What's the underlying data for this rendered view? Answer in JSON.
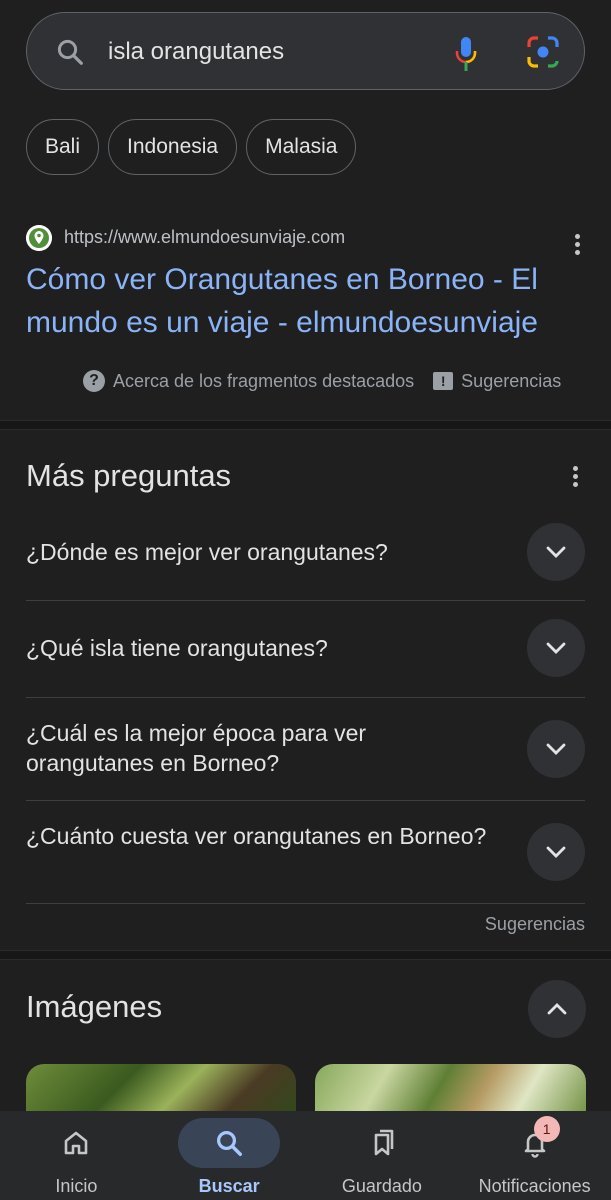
{
  "search": {
    "query": "isla orangutanes",
    "placeholder": "",
    "mic_icon": "mic-icon",
    "lens_icon": "google-lens-icon"
  },
  "chips": [
    "Bali",
    "Indonesia",
    "Malasia"
  ],
  "result": {
    "url": "https://www.elmundoesunviaje.com",
    "title": "Cómo ver Orangutanes en Borneo - El mundo es un viaje - elmundoesunviaje",
    "about_snippets": "Acerca de los fragmentos destacados",
    "suggestions": "Sugerencias"
  },
  "more_questions": {
    "title": "Más preguntas",
    "items": [
      "¿Dónde es mejor ver orangutanes?",
      "¿Qué isla tiene orangutanes?",
      "¿Cuál es la mejor época para ver orangutanes en Borneo?",
      "¿Cuánto cuesta ver orangutanes en Borneo?"
    ],
    "suggestions": "Sugerencias"
  },
  "images": {
    "title": "Imágenes"
  },
  "bottom_nav": {
    "items": [
      {
        "label": "Inicio",
        "icon": "home-icon"
      },
      {
        "label": "Buscar",
        "icon": "search-icon"
      },
      {
        "label": "Guardado",
        "icon": "bookmarks-icon"
      },
      {
        "label": "Notificaciones",
        "icon": "bell-icon"
      }
    ],
    "notification_badge": "1"
  },
  "colors": {
    "background": "#1f1f1f",
    "link": "#8ab4f8",
    "active_nav": "#a8c7fa"
  }
}
